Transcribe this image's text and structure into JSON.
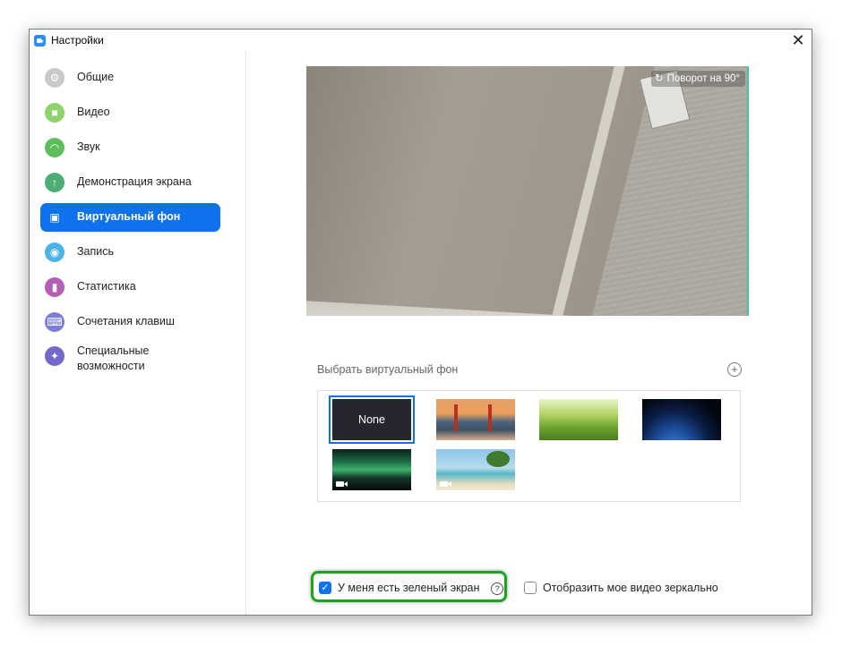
{
  "window": {
    "title": "Настройки",
    "close_glyph": "✕"
  },
  "sidebar": {
    "items": [
      {
        "label": "Общие",
        "icon": "gear-icon",
        "color": "#c9c9c9",
        "glyph": "⚙",
        "active": false
      },
      {
        "label": "Видео",
        "icon": "video-camera-icon",
        "color": "#8fd46b",
        "glyph": "■",
        "active": false
      },
      {
        "label": "Звук",
        "icon": "headphones-icon",
        "color": "#5ebd5b",
        "glyph": "◠",
        "active": false
      },
      {
        "label": "Демонстрация экрана",
        "icon": "share-screen-icon",
        "color": "#4cad75",
        "glyph": "↑",
        "active": false
      },
      {
        "label": "Виртуальный фон",
        "icon": "virtual-background-icon",
        "color": "#0e72ed",
        "glyph": "▣",
        "active": true
      },
      {
        "label": "Запись",
        "icon": "record-icon",
        "color": "#4bb3e6",
        "glyph": "◉",
        "active": false
      },
      {
        "label": "Статистика",
        "icon": "statistics-icon",
        "color": "#b35fb4",
        "glyph": "▮",
        "active": false
      },
      {
        "label": "Сочетания клавиш",
        "icon": "keyboard-icon",
        "color": "#7b7dd6",
        "glyph": "⌨",
        "active": false
      },
      {
        "label": "Специальные возможности",
        "icon": "accessibility-icon",
        "color": "#7368c9",
        "glyph": "✦",
        "active": false
      }
    ]
  },
  "preview": {
    "rotate_label": "Поворот на 90°",
    "rotate_glyph": "↻"
  },
  "backgrounds": {
    "section_label": "Выбрать виртуальный фон",
    "add_glyph": "+",
    "items": [
      {
        "label": "None",
        "kind": "none",
        "selected": true
      },
      {
        "label": "",
        "kind": "golden-gate-bridge",
        "selected": false
      },
      {
        "label": "",
        "kind": "grass",
        "selected": false
      },
      {
        "label": "",
        "kind": "earth-from-space",
        "selected": false
      },
      {
        "label": "",
        "kind": "aurora-video",
        "selected": false
      },
      {
        "label": "",
        "kind": "beach-video",
        "selected": false
      }
    ]
  },
  "options": {
    "green_screen_label": "У меня есть зеленый экран",
    "green_screen_checked": true,
    "help_glyph": "?",
    "check_glyph": "✓",
    "mirror_label": "Отобразить мое видео зеркально",
    "mirror_checked": false
  },
  "colors": {
    "accent": "#0e72ed",
    "highlight": "#19a51a"
  }
}
